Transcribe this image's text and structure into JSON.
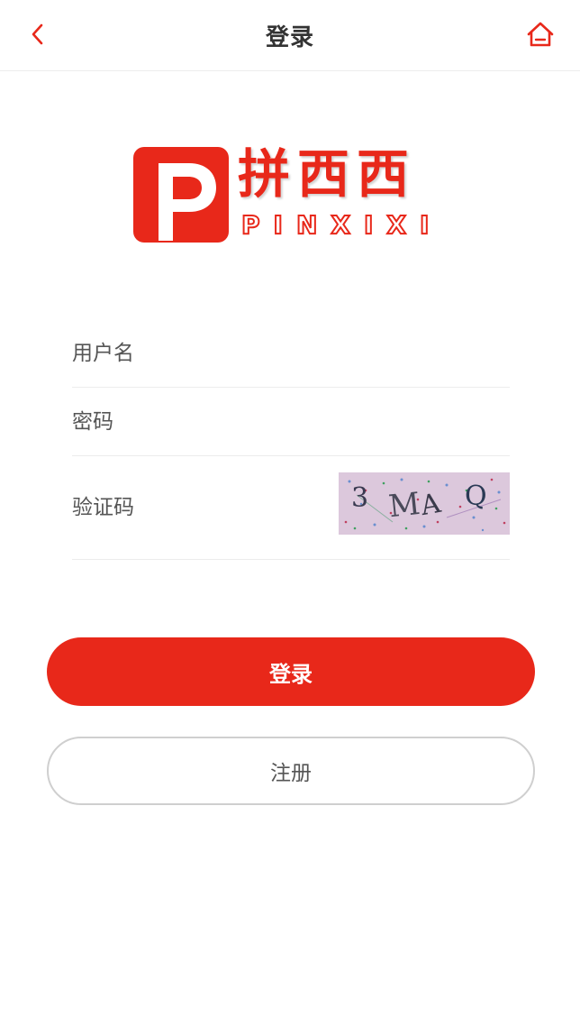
{
  "header": {
    "title": "登录",
    "back_icon": "chevron-left-icon",
    "home_icon": "home-icon"
  },
  "logo": {
    "brand_cn": "拼西西",
    "brand_en": "PINXIXI",
    "mark_letter": "P"
  },
  "form": {
    "username": {
      "placeholder": "用户名",
      "value": ""
    },
    "password": {
      "placeholder": "密码",
      "value": ""
    },
    "captcha": {
      "placeholder": "验证码",
      "value": "",
      "image_text": "3 MAQ"
    }
  },
  "buttons": {
    "login_label": "登录",
    "register_label": "注册"
  },
  "colors": {
    "accent": "#e8281a",
    "text": "#333333",
    "placeholder": "#555555",
    "divider": "#ececec",
    "captcha_bg": "#dcc8dc"
  }
}
